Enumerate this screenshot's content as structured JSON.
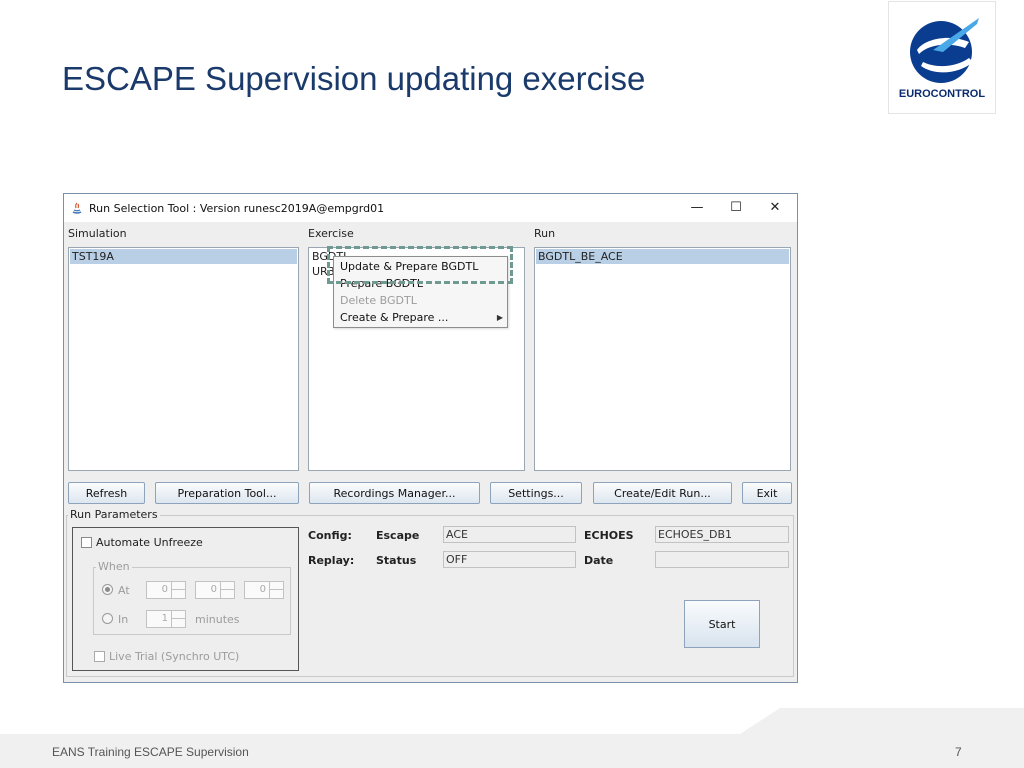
{
  "slide": {
    "title": "ESCAPE Supervision updating exercise",
    "logo_text": "EUROCONTROL",
    "footer": "EANS Training ESCAPE Supervision",
    "page_number": "7"
  },
  "window": {
    "title": "Run Selection Tool : Version runesc2019A@empgrd01",
    "minimize_glyph": "—",
    "maximize_glyph": "☐",
    "close_glyph": "✕"
  },
  "columns": {
    "simulation": {
      "label": "Simulation",
      "items": [
        "TST19A"
      ],
      "selected": "TST19A"
    },
    "exercise": {
      "label": "Exercise",
      "items": [
        "BGDTL",
        "UR3"
      ],
      "selected": "BGDTL"
    },
    "run": {
      "label": "Run",
      "items": [
        "BGDTL_BE_ACE"
      ],
      "selected": "BGDTL_BE_ACE"
    }
  },
  "context_menu": {
    "items": [
      {
        "label": "Update & Prepare BGDTL",
        "enabled": true
      },
      {
        "label": "Prepare BGDTL",
        "enabled": true
      },
      {
        "label": "Delete BGDTL",
        "enabled": false
      },
      {
        "label": "Create & Prepare ...",
        "enabled": true,
        "submenu": true
      }
    ],
    "highlighted": "Update & Prepare BGDTL"
  },
  "buttons": {
    "refresh": "Refresh",
    "preparation_tool": "Preparation Tool...",
    "recordings_manager": "Recordings Manager...",
    "settings": "Settings...",
    "create_edit_run": "Create/Edit Run...",
    "exit": "Exit",
    "start": "Start"
  },
  "run_parameters": {
    "label": "Run Parameters",
    "automate_unfreeze": {
      "label": "Automate Unfreeze",
      "checked": false
    },
    "when": {
      "label": "When",
      "at": {
        "label": "At",
        "checked": true,
        "values": [
          "0",
          "0",
          "0"
        ]
      },
      "in": {
        "label": "In",
        "checked": false,
        "value": "1",
        "unit": "minutes"
      }
    },
    "live_trial": {
      "label": "Live Trial (Synchro UTC)",
      "checked": false
    }
  },
  "config": {
    "config_label": "Config:",
    "escape_label": "Escape",
    "escape_value": "ACE",
    "echoes_label": "ECHOES",
    "echoes_value": "ECHOES_DB1",
    "replay_label": "Replay:",
    "status_label": "Status",
    "status_value": "OFF",
    "date_label": "Date",
    "date_value": ""
  },
  "colors": {
    "title_blue": "#1a3a6b",
    "selection": "#b8cfe5",
    "highlight_dash": "#6e9a92"
  }
}
